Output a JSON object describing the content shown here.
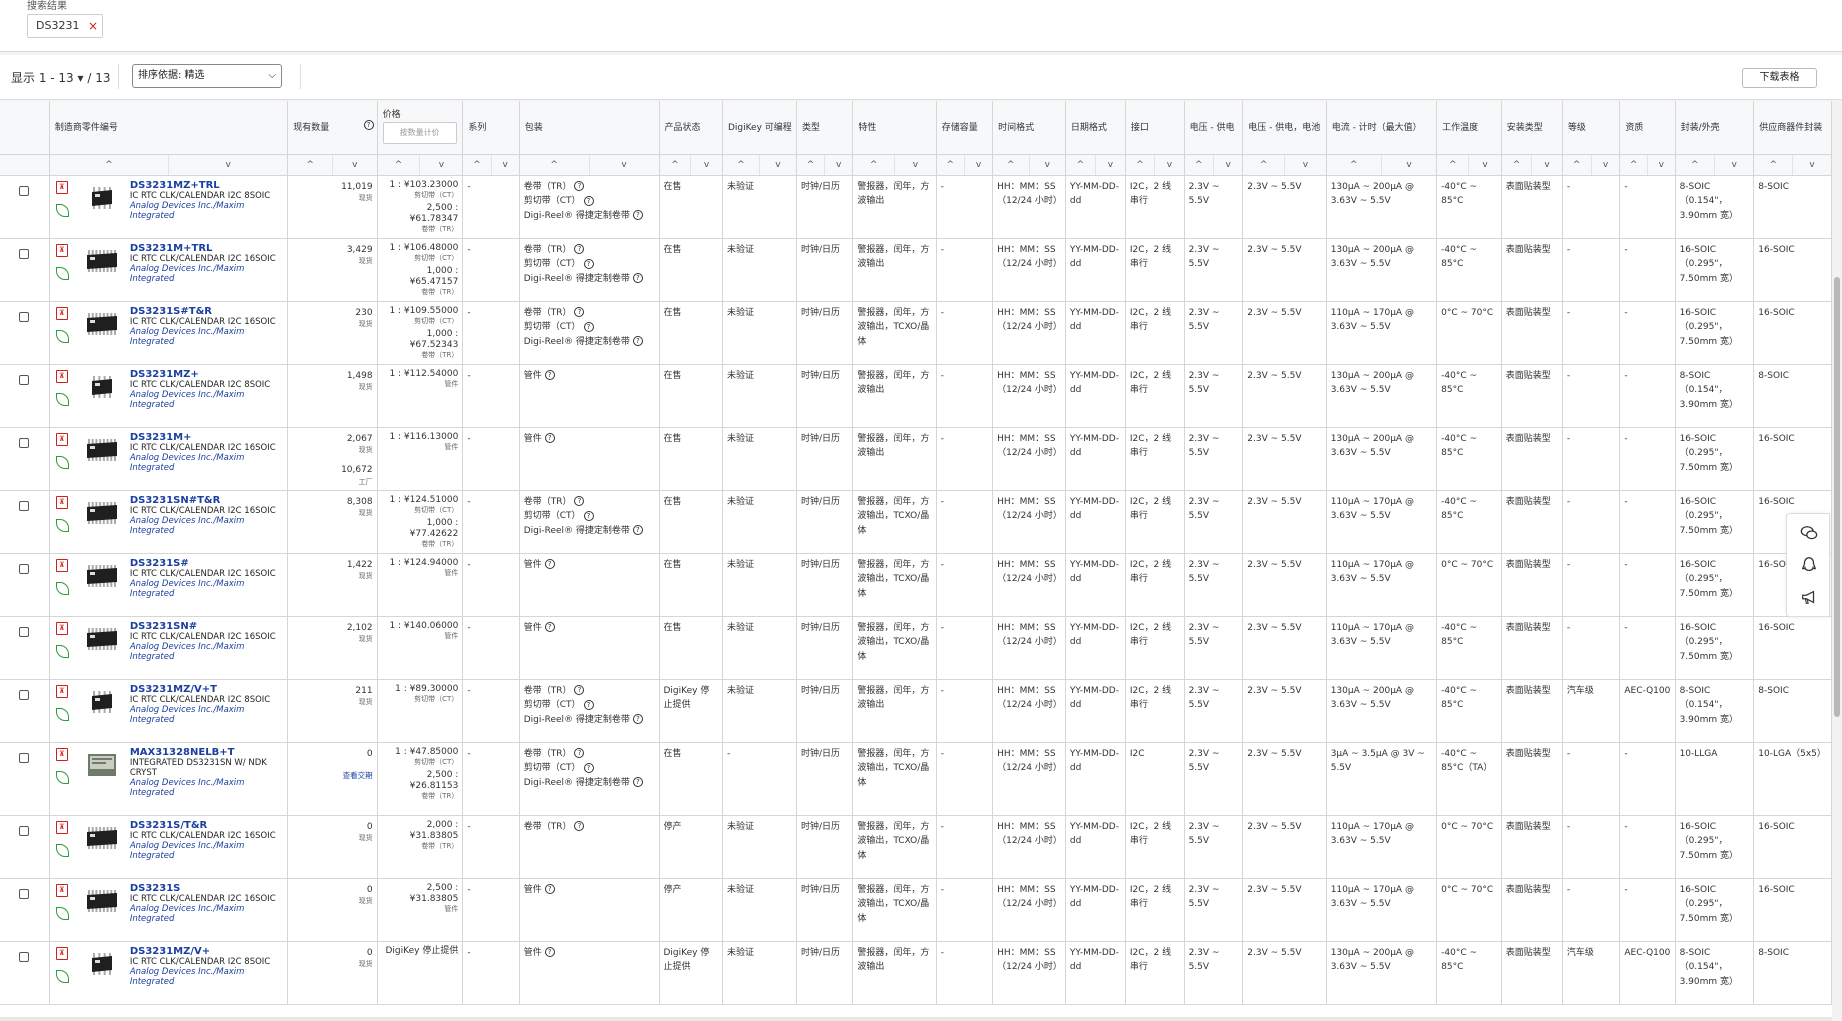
{
  "filter": {
    "label": "搜索结果",
    "chip": "DS3231",
    "chip_remove": "×"
  },
  "toolbar": {
    "showing": "显示 1 - 13 ▾ / 13",
    "sort_label": "排序依据: 精选",
    "sort_caret": "⌵",
    "download": "下载表格"
  },
  "columns": [
    "",
    "制造商零件编号",
    "现有数量",
    "价格",
    "系列",
    "包装",
    "产品状态",
    "DigiKey 可编程",
    "类型",
    "特性",
    "存储容量",
    "时间格式",
    "日期格式",
    "接口",
    "电压 - 供电",
    "电压 - 供电，电池",
    "电流 - 计时（最大值）",
    "工作温度",
    "安装类型",
    "等级",
    "资质",
    "封装/外壳",
    "供应商器件封装"
  ],
  "price_placeholder": "按数量计价",
  "sort_up": "^",
  "sort_down": "v",
  "rows": [
    {
      "pn": "DS3231MZ+TRL",
      "desc": "IC RTC CLK/CALENDAR I2C 8SOIC",
      "mfr": "Analog Devices Inc./Maxim Integrated",
      "pkgimg": "8soic",
      "qty": "11,019",
      "qty_sub": "现货",
      "prices": [
        {
          "p": "1 : ¥103.23000",
          "t": "剪切带（CT）"
        },
        {
          "p": "2,500 : ¥61.78347",
          "t": "卷带（TR）"
        }
      ],
      "series": "-",
      "pkg": [
        "卷带（TR）",
        "剪切带（CT）",
        "Digi-Reel® 得捷定制卷带"
      ],
      "status": "在售",
      "prog": "未验证",
      "type": "时钟/日历",
      "feat": "警报器，闰年，方波输出",
      "mem": "-",
      "tfmt": "HH：MM：SS（12/24 小时）",
      "dfmt": "YY-MM-DD-dd",
      "iface": "I2C，2 线串行",
      "vsup": "2.3V ~ 5.5V",
      "vbat": "2.3V ~ 5.5V",
      "icur": "130µA ~ 200µA @ 3.63V ~ 5.5V",
      "temp": "-40°C ~ 85°C",
      "mount": "表面贴装型",
      "grade": "-",
      "qual": "-",
      "case": "8-SOIC（0.154\"，3.90mm 宽）",
      "spkg": "8-SOIC"
    },
    {
      "pn": "DS3231M+TRL",
      "desc": "IC RTC CLK/CALENDAR I2C 16SOIC",
      "mfr": "Analog Devices Inc./Maxim Integrated",
      "pkgimg": "16soic",
      "qty": "3,429",
      "qty_sub": "现货",
      "prices": [
        {
          "p": "1 : ¥106.48000",
          "t": "剪切带（CT）"
        },
        {
          "p": "1,000 : ¥65.47157",
          "t": "卷带（TR）"
        }
      ],
      "series": "-",
      "pkg": [
        "卷带（TR）",
        "剪切带（CT）",
        "Digi-Reel® 得捷定制卷带"
      ],
      "status": "在售",
      "prog": "未验证",
      "type": "时钟/日历",
      "feat": "警报器，闰年，方波输出",
      "mem": "-",
      "tfmt": "HH：MM：SS（12/24 小时）",
      "dfmt": "YY-MM-DD-dd",
      "iface": "I2C，2 线串行",
      "vsup": "2.3V ~ 5.5V",
      "vbat": "2.3V ~ 5.5V",
      "icur": "130µA ~ 200µA @ 3.63V ~ 5.5V",
      "temp": "-40°C ~ 85°C",
      "mount": "表面贴装型",
      "grade": "-",
      "qual": "-",
      "case": "16-SOIC（0.295\"，7.50mm 宽）",
      "spkg": "16-SOIC"
    },
    {
      "pn": "DS3231S#T&R",
      "desc": "IC RTC CLK/CALENDAR I2C 16SOIC",
      "mfr": "Analog Devices Inc./Maxim Integrated",
      "pkgimg": "16soic",
      "qty": "230",
      "qty_sub": "现货",
      "prices": [
        {
          "p": "1 : ¥109.55000",
          "t": "剪切带（CT）"
        },
        {
          "p": "1,000 : ¥67.52343",
          "t": "卷带（TR）"
        }
      ],
      "series": "-",
      "pkg": [
        "卷带（TR）",
        "剪切带（CT）",
        "Digi-Reel® 得捷定制卷带"
      ],
      "status": "在售",
      "prog": "未验证",
      "type": "时钟/日历",
      "feat": "警报器，闰年，方波输出，TCXO/晶体",
      "mem": "-",
      "tfmt": "HH：MM：SS（12/24 小时）",
      "dfmt": "YY-MM-DD-dd",
      "iface": "I2C，2 线串行",
      "vsup": "2.3V ~ 5.5V",
      "vbat": "2.3V ~ 5.5V",
      "icur": "110µA ~ 170µA @ 3.63V ~ 5.5V",
      "temp": "0°C ~ 70°C",
      "mount": "表面贴装型",
      "grade": "-",
      "qual": "-",
      "case": "16-SOIC（0.295\"，7.50mm 宽）",
      "spkg": "16-SOIC"
    },
    {
      "pn": "DS3231MZ+",
      "desc": "IC RTC CLK/CALENDAR I2C 8SOIC",
      "mfr": "Analog Devices Inc./Maxim Integrated",
      "pkgimg": "8soic",
      "qty": "1,498",
      "qty_sub": "现货",
      "prices": [
        {
          "p": "1 : ¥112.54000",
          "t": "管件"
        }
      ],
      "series": "-",
      "pkg": [
        "管件"
      ],
      "status": "在售",
      "prog": "未验证",
      "type": "时钟/日历",
      "feat": "警报器，闰年，方波输出",
      "mem": "-",
      "tfmt": "HH：MM：SS（12/24 小时）",
      "dfmt": "YY-MM-DD-dd",
      "iface": "I2C，2 线串行",
      "vsup": "2.3V ~ 5.5V",
      "vbat": "2.3V ~ 5.5V",
      "icur": "130µA ~ 200µA @ 3.63V ~ 5.5V",
      "temp": "-40°C ~ 85°C",
      "mount": "表面贴装型",
      "grade": "-",
      "qual": "-",
      "case": "8-SOIC（0.154\"，3.90mm 宽）",
      "spkg": "8-SOIC"
    },
    {
      "pn": "DS3231M+",
      "desc": "IC RTC CLK/CALENDAR I2C 16SOIC",
      "mfr": "Analog Devices Inc./Maxim Integrated",
      "pkgimg": "16soic",
      "qty": "2,067",
      "qty_sub": "现货",
      "qty2": "10,672",
      "qty2_sub": "工厂",
      "prices": [
        {
          "p": "1 : ¥116.13000",
          "t": "管件"
        }
      ],
      "series": "-",
      "pkg": [
        "管件"
      ],
      "status": "在售",
      "prog": "未验证",
      "type": "时钟/日历",
      "feat": "警报器，闰年，方波输出",
      "mem": "-",
      "tfmt": "HH：MM：SS（12/24 小时）",
      "dfmt": "YY-MM-DD-dd",
      "iface": "I2C，2 线串行",
      "vsup": "2.3V ~ 5.5V",
      "vbat": "2.3V ~ 5.5V",
      "icur": "130µA ~ 200µA @ 3.63V ~ 5.5V",
      "temp": "-40°C ~ 85°C",
      "mount": "表面贴装型",
      "grade": "-",
      "qual": "-",
      "case": "16-SOIC（0.295\"，7.50mm 宽）",
      "spkg": "16-SOIC"
    },
    {
      "pn": "DS3231SN#T&R",
      "desc": "IC RTC CLK/CALENDAR I2C 16SOIC",
      "mfr": "Analog Devices Inc./Maxim Integrated",
      "pkgimg": "16soic",
      "qty": "8,308",
      "qty_sub": "现货",
      "prices": [
        {
          "p": "1 : ¥124.51000",
          "t": "剪切带（CT）"
        },
        {
          "p": "1,000 : ¥77.42622",
          "t": "卷带（TR）"
        }
      ],
      "series": "-",
      "pkg": [
        "卷带（TR）",
        "剪切带（CT）",
        "Digi-Reel® 得捷定制卷带"
      ],
      "status": "在售",
      "prog": "未验证",
      "type": "时钟/日历",
      "feat": "警报器，闰年，方波输出，TCXO/晶体",
      "mem": "-",
      "tfmt": "HH：MM：SS（12/24 小时）",
      "dfmt": "YY-MM-DD-dd",
      "iface": "I2C，2 线串行",
      "vsup": "2.3V ~ 5.5V",
      "vbat": "2.3V ~ 5.5V",
      "icur": "110µA ~ 170µA @ 3.63V ~ 5.5V",
      "temp": "-40°C ~ 85°C",
      "mount": "表面贴装型",
      "grade": "-",
      "qual": "-",
      "case": "16-SOIC（0.295\"，7.50mm 宽）",
      "spkg": "16-SOIC"
    },
    {
      "pn": "DS3231S#",
      "desc": "IC RTC CLK/CALENDAR I2C 16SOIC",
      "mfr": "Analog Devices Inc./Maxim Integrated",
      "pkgimg": "16soic",
      "qty": "1,422",
      "qty_sub": "现货",
      "prices": [
        {
          "p": "1 : ¥124.94000",
          "t": "管件"
        }
      ],
      "series": "-",
      "pkg": [
        "管件"
      ],
      "status": "在售",
      "prog": "未验证",
      "type": "时钟/日历",
      "feat": "警报器，闰年，方波输出，TCXO/晶体",
      "mem": "-",
      "tfmt": "HH：MM：SS（12/24 小时）",
      "dfmt": "YY-MM-DD-dd",
      "iface": "I2C，2 线串行",
      "vsup": "2.3V ~ 5.5V",
      "vbat": "2.3V ~ 5.5V",
      "icur": "110µA ~ 170µA @ 3.63V ~ 5.5V",
      "temp": "0°C ~ 70°C",
      "mount": "表面贴装型",
      "grade": "-",
      "qual": "-",
      "case": "16-SOIC（0.295\"，7.50mm 宽）",
      "spkg": "16-SO"
    },
    {
      "pn": "DS3231SN#",
      "desc": "IC RTC CLK/CALENDAR I2C 16SOIC",
      "mfr": "Analog Devices Inc./Maxim Integrated",
      "pkgimg": "16soic",
      "qty": "2,102",
      "qty_sub": "现货",
      "prices": [
        {
          "p": "1 : ¥140.06000",
          "t": "管件"
        }
      ],
      "series": "-",
      "pkg": [
        "管件"
      ],
      "status": "在售",
      "prog": "未验证",
      "type": "时钟/日历",
      "feat": "警报器，闰年，方波输出，TCXO/晶体",
      "mem": "-",
      "tfmt": "HH：MM：SS（12/24 小时）",
      "dfmt": "YY-MM-DD-dd",
      "iface": "I2C，2 线串行",
      "vsup": "2.3V ~ 5.5V",
      "vbat": "2.3V ~ 5.5V",
      "icur": "110µA ~ 170µA @ 3.63V ~ 5.5V",
      "temp": "-40°C ~ 85°C",
      "mount": "表面贴装型",
      "grade": "-",
      "qual": "-",
      "case": "16-SOIC（0.295\"，7.50mm 宽）",
      "spkg": "16-SOIC"
    },
    {
      "pn": "DS3231MZ/V+T",
      "desc": "IC RTC CLK/CALENDAR I2C 8SOIC",
      "mfr": "Analog Devices Inc./Maxim Integrated",
      "pkgimg": "8soic",
      "qty": "211",
      "qty_sub": "现货",
      "prices": [
        {
          "p": "1 : ¥89.30000",
          "t": "剪切带（CT）"
        }
      ],
      "series": "-",
      "pkg": [
        "卷带（TR）",
        "剪切带（CT）",
        "Digi-Reel® 得捷定制卷带"
      ],
      "status": "DigiKey 停止提供",
      "prog": "未验证",
      "type": "时钟/日历",
      "feat": "警报器，闰年，方波输出",
      "mem": "-",
      "tfmt": "HH：MM：SS（12/24 小时）",
      "dfmt": "YY-MM-DD-dd",
      "iface": "I2C，2 线串行",
      "vsup": "2.3V ~ 5.5V",
      "vbat": "2.3V ~ 5.5V",
      "icur": "130µA ~ 200µA @ 3.63V ~ 5.5V",
      "temp": "-40°C ~ 85°C",
      "mount": "表面贴装型",
      "grade": "汽车级",
      "qual": "AEC-Q100",
      "case": "8-SOIC（0.154\"，3.90mm 宽）",
      "spkg": "8-SOIC"
    },
    {
      "pn": "MAX31328NELB+T",
      "desc": "INTEGRATED DS3231SN W/ NDK CRYST",
      "mfr": "Analog Devices Inc./Maxim Integrated",
      "pkgimg": "lga",
      "tall": true,
      "qty": "0",
      "qty_sub": "",
      "qty_link": "查看交期",
      "prices": [
        {
          "p": "1 : ¥47.85000",
          "t": "剪切带（CT）"
        },
        {
          "p": "2,500 : ¥26.81153",
          "t": "卷带（TR）"
        }
      ],
      "series": "-",
      "pkg": [
        "卷带（TR）",
        "剪切带（CT）",
        "Digi-Reel® 得捷定制卷带"
      ],
      "status": "在售",
      "prog": "-",
      "type": "时钟/日历",
      "feat": "警报器，闰年，方波输出，TCXO/晶体",
      "mem": "-",
      "tfmt": "HH：MM：SS（12/24 小时）",
      "dfmt": "YY-MM-DD-dd",
      "iface": "I2C",
      "vsup": "2.3V ~ 5.5V",
      "vbat": "2.3V ~ 5.5V",
      "icur": "3µA ~ 3.5µA @ 3V ~ 5.5V",
      "temp": "-40°C ~ 85°C（TA）",
      "mount": "表面贴装型",
      "grade": "-",
      "qual": "-",
      "case": "10-LLGA",
      "spkg": "10-LGA（5x5）"
    },
    {
      "pn": "DS3231S/T&R",
      "desc": "IC RTC CLK/CALENDAR I2C 16SOIC",
      "mfr": "Analog Devices Inc./Maxim Integrated",
      "pkgimg": "16soic",
      "qty": "0",
      "qty_sub": "现货",
      "prices": [
        {
          "p": "2,000 : ¥31.83805",
          "t": "卷带（TR）"
        }
      ],
      "series": "-",
      "pkg": [
        "卷带（TR）"
      ],
      "status": "停产",
      "prog": "未验证",
      "type": "时钟/日历",
      "feat": "警报器，闰年，方波输出，TCXO/晶体",
      "mem": "-",
      "tfmt": "HH：MM：SS（12/24 小时）",
      "dfmt": "YY-MM-DD-dd",
      "iface": "I2C，2 线串行",
      "vsup": "2.3V ~ 5.5V",
      "vbat": "2.3V ~ 5.5V",
      "icur": "110µA ~ 170µA @ 3.63V ~ 5.5V",
      "temp": "0°C ~ 70°C",
      "mount": "表面贴装型",
      "grade": "-",
      "qual": "-",
      "case": "16-SOIC（0.295\"，7.50mm 宽）",
      "spkg": "16-SOIC"
    },
    {
      "pn": "DS3231S",
      "desc": "IC RTC CLK/CALENDAR I2C 16SOIC",
      "mfr": "Analog Devices Inc./Maxim Integrated",
      "pkgimg": "16soic",
      "qty": "0",
      "qty_sub": "现货",
      "prices": [
        {
          "p": "2,500 : ¥31.83805",
          "t": "管件"
        }
      ],
      "series": "-",
      "pkg": [
        "管件"
      ],
      "status": "停产",
      "prog": "未验证",
      "type": "时钟/日历",
      "feat": "警报器，闰年，方波输出，TCXO/晶体",
      "mem": "-",
      "tfmt": "HH：MM：SS（12/24 小时）",
      "dfmt": "YY-MM-DD-dd",
      "iface": "I2C，2 线串行",
      "vsup": "2.3V ~ 5.5V",
      "vbat": "2.3V ~ 5.5V",
      "icur": "110µA ~ 170µA @ 3.63V ~ 5.5V",
      "temp": "0°C ~ 70°C",
      "mount": "表面贴装型",
      "grade": "-",
      "qual": "-",
      "case": "16-SOIC（0.295\"，7.50mm 宽）",
      "spkg": "16-SOIC"
    },
    {
      "pn": "DS3231MZ/V+",
      "desc": "IC RTC CLK/CALENDAR I2C 8SOIC",
      "mfr": "Analog Devices Inc./Maxim Integrated",
      "pkgimg": "8soic",
      "qty": "0",
      "qty_sub": "现货",
      "prices": [
        {
          "p": "DigiKey 停止提供",
          "t": ""
        }
      ],
      "series": "-",
      "pkg": [
        "管件"
      ],
      "status": "DigiKey 停止提供",
      "prog": "未验证",
      "type": "时钟/日历",
      "feat": "警报器，闰年，方波输出",
      "mem": "-",
      "tfmt": "HH：MM：SS（12/24 小时）",
      "dfmt": "YY-MM-DD-dd",
      "iface": "I2C，2 线串行",
      "vsup": "2.3V ~ 5.5V",
      "vbat": "2.3V ~ 5.5V",
      "icur": "130µA ~ 200µA @ 3.63V ~ 5.5V",
      "temp": "-40°C ~ 85°C",
      "mount": "表面贴装型",
      "grade": "汽车级",
      "qual": "AEC-Q100",
      "case": "8-SOIC（0.154\"，3.90mm 宽）",
      "spkg": "8-SOIC"
    }
  ],
  "icons": {
    "pdf": "pdf-icon",
    "leaf": "rohs-leaf-icon",
    "help": "help-icon",
    "chat": "wechat-icon",
    "qq": "qq-icon",
    "announce": "megaphone-icon"
  },
  "colors": {
    "link": "#1a3fa0",
    "pdf": "#d0201c",
    "leaf": "#2e9c3a"
  }
}
